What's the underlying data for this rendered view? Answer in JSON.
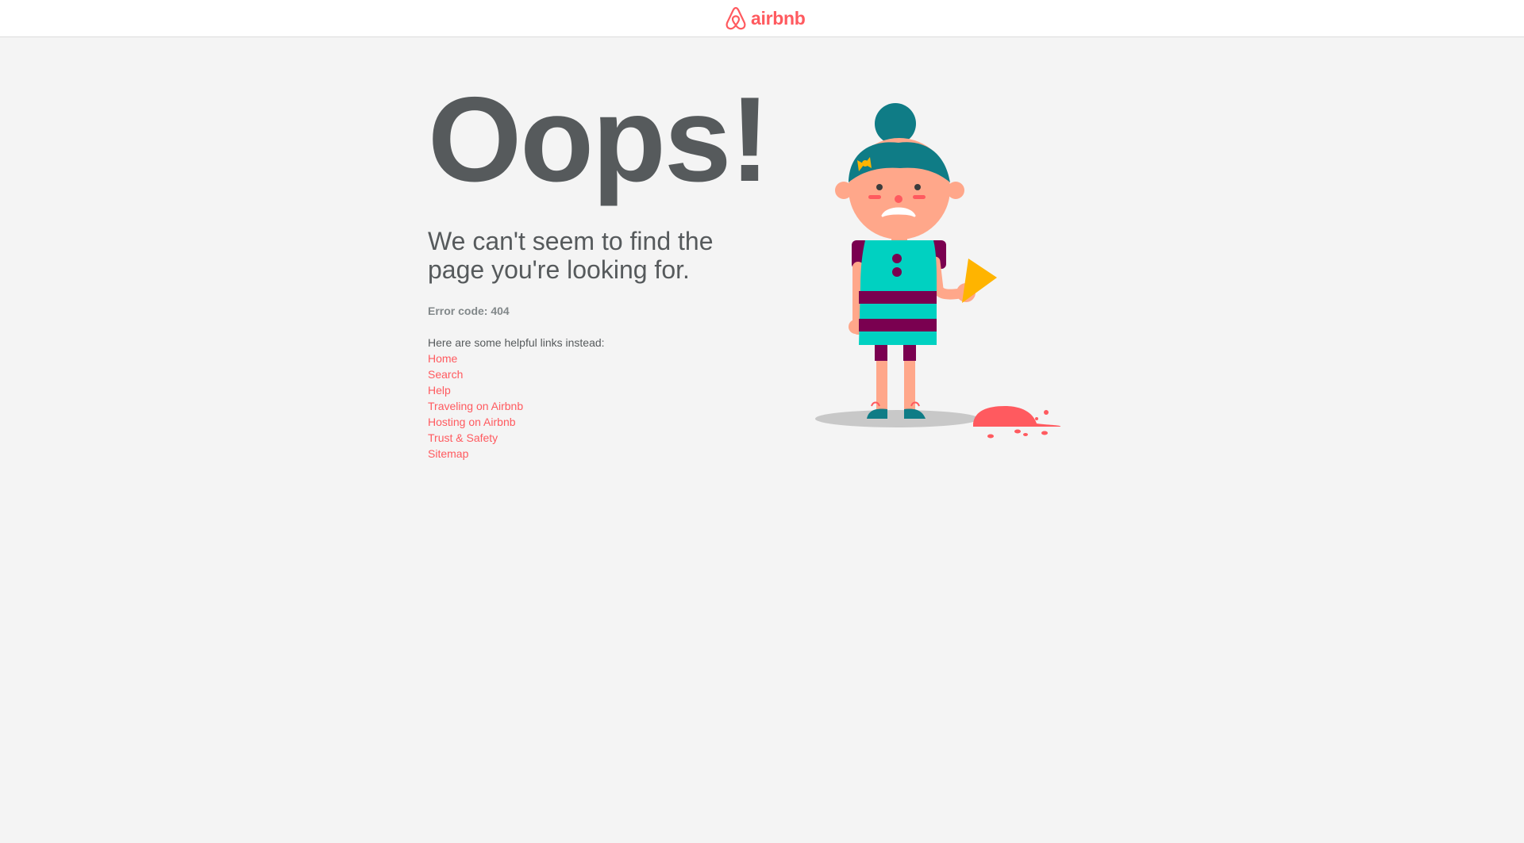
{
  "header": {
    "logo_text": "airbnb",
    "logo_icon": "airbnb-belo-icon",
    "brand_color": "#ff5a5f"
  },
  "main": {
    "heading": "Oops!",
    "subtitle": "We can't seem to find the page you're looking for.",
    "error_code": "Error code: 404",
    "links_intro": "Here are some helpful links instead:",
    "links": [
      {
        "label": "Home"
      },
      {
        "label": "Search"
      },
      {
        "label": "Help"
      },
      {
        "label": "Traveling on Airbnb"
      },
      {
        "label": "Hosting on Airbnb"
      },
      {
        "label": "Trust & Safety"
      },
      {
        "label": "Sitemap"
      }
    ]
  },
  "illustration": {
    "icon": "sad-girl-dropped-ice-cream-icon"
  },
  "colors": {
    "background": "#f4f4f4",
    "text": "#565a5c",
    "muted": "#82888a",
    "link": "#ff5a5f"
  }
}
